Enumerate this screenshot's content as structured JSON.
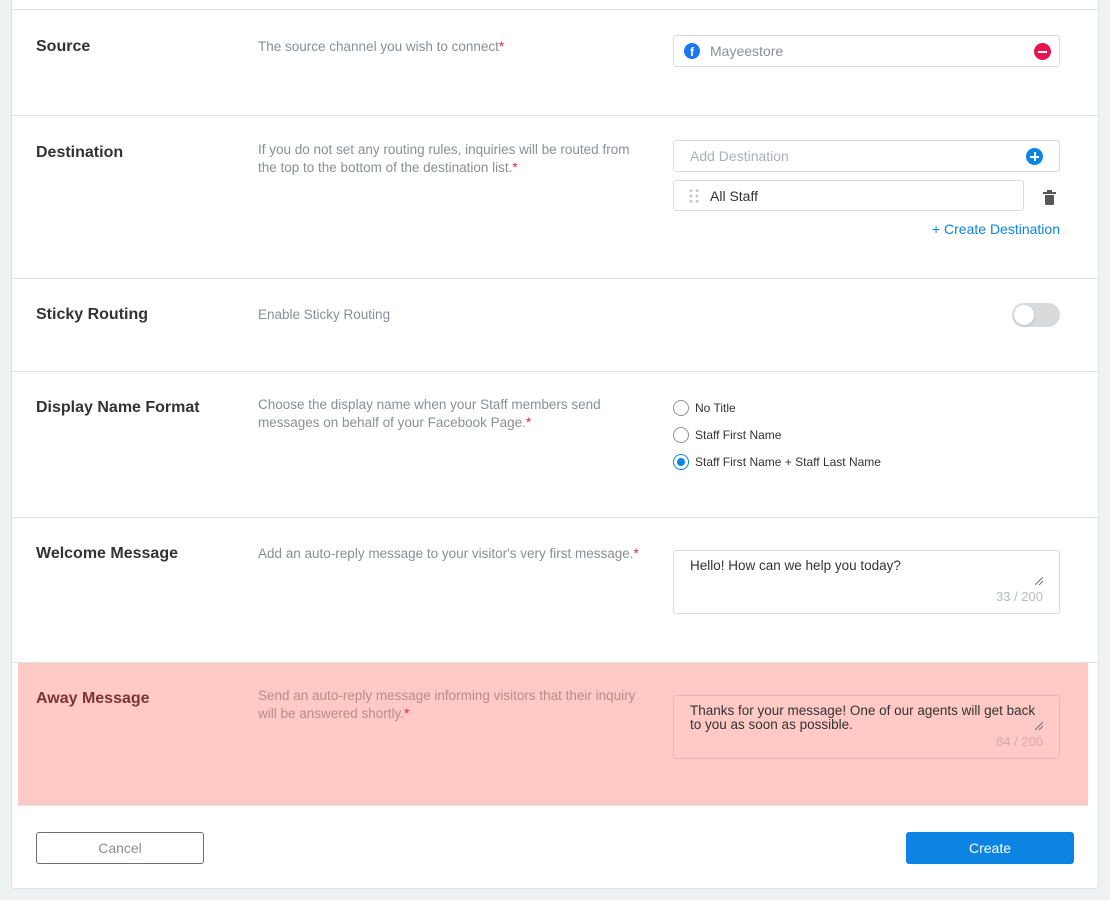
{
  "source": {
    "title": "Source",
    "description": "The source channel you wish to connect",
    "required_mark": "*",
    "channel_name": "Mayeestore",
    "channel_icon": "facebook-icon"
  },
  "destination": {
    "title": "Destination",
    "description": "If you do not set any routing rules, inquiries will be routed from the top to the bottom of the destination list.",
    "required_mark": "*",
    "add_placeholder": "Add Destination",
    "items": [
      "All Staff"
    ],
    "create_link": "+ Create Destination"
  },
  "sticky_routing": {
    "title": "Sticky Routing",
    "description": "Enable Sticky Routing",
    "enabled": false
  },
  "display_name_format": {
    "title": "Display Name Format",
    "description": "Choose the display name when your Staff members send messages on behalf of your Facebook Page.",
    "required_mark": "*",
    "options": [
      "No Title",
      "Staff First Name",
      "Staff First Name + Staff Last Name"
    ],
    "selected": "Staff First Name + Staff Last Name"
  },
  "welcome_message": {
    "title": "Welcome Message",
    "description": "Add an auto-reply message to your visitor's very first message.",
    "required_mark": "*",
    "value": "Hello! How can we help you today?",
    "counter": "33 / 200"
  },
  "away_message": {
    "title": "Away Message",
    "description": "Send an auto-reply message informing visitors that their inquiry will be answered shortly.",
    "required_mark": "*",
    "value": "Thanks for your message! One of our agents will get back to you as soon as possible.",
    "counter": "84 / 200"
  },
  "footer": {
    "cancel_label": "Cancel",
    "create_label": "Create"
  },
  "colors": {
    "accent": "#0b84e3",
    "danger": "#e8134f",
    "highlight": "#ffc9c6"
  }
}
